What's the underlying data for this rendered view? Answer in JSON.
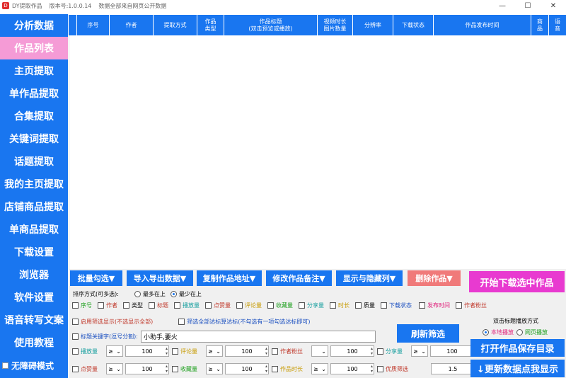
{
  "title": {
    "app_name": "DY提取作品",
    "version": "版本号:1.0.0.14",
    "note": "数据全部来自网页公开数据",
    "controls": [
      "—",
      "☐",
      "✕"
    ]
  },
  "sidebar": {
    "items": [
      "分析数据",
      "作品列表",
      "主页提取",
      "单作品提取",
      "合集提取",
      "关键词提取",
      "话题提取",
      "我的主页提取",
      "店铺商品提取",
      "单商品提取",
      "下载设置",
      "浏览器",
      "软件设置",
      "语音转写文案",
      "使用教程"
    ],
    "accessibility": "无障碍模式"
  },
  "table": {
    "headers": [
      "序号",
      "作者",
      "提取方式",
      "作品\n类型",
      "作品标题\n(双击预览或播放)",
      "视频时长\n图片数量",
      "分辨率",
      "下载状态",
      "作品发布时间",
      "商\n品",
      "语\n音"
    ]
  },
  "toolbar": {
    "batch_select": "批量勾选▼",
    "import_export": "导入导出数据▼",
    "copy_url": "复制作品地址▼",
    "edit_note": "修改作品备注▼",
    "show_hide": "显示与隐藏列▼",
    "delete": "删除作品▼",
    "start_download": "开始下载选中作品"
  },
  "sort": {
    "label": "排序方式(可多选):",
    "opt_most": "最多在上",
    "opt_least": "最少在上"
  },
  "columns": [
    {
      "label": "序号",
      "color": "#1a9e1a"
    },
    {
      "label": "作者",
      "color": "#c0392b"
    },
    {
      "label": "类型",
      "color": "#000000"
    },
    {
      "label": "标题",
      "color": "#c0392b"
    },
    {
      "label": "播放量",
      "color": "#1aa0a0"
    },
    {
      "label": "点赞量",
      "color": "#c0392b"
    },
    {
      "label": "评论量",
      "color": "#c79a00"
    },
    {
      "label": "收藏量",
      "color": "#1a9e1a"
    },
    {
      "label": "分享量",
      "color": "#1aa0a0"
    },
    {
      "label": "时长",
      "color": "#c79a00"
    },
    {
      "label": "质量",
      "color": "#000000"
    },
    {
      "label": "下载状态",
      "color": "#1a4fc0"
    },
    {
      "label": "发布时间",
      "color": "#e0207a"
    },
    {
      "label": "作者粉丝",
      "color": "#c0392b"
    }
  ],
  "filter": {
    "enable": "启用筛选显示(不选显示全部)",
    "all_match": "筛选全部达标算达标(不勾选有一项勾选达标即可)",
    "keyword_label": "标题关键字(逗号分割):",
    "keyword_value": "小助手,要火",
    "refresh": "刷新筛选",
    "op": "≥",
    "row1": [
      {
        "label": "播放量",
        "color": "#1aa0a0",
        "value": "100"
      },
      {
        "label": "评论量",
        "color": "#c79a00",
        "value": "100"
      },
      {
        "label": "作者粉丝",
        "color": "#c0392b",
        "value": "100"
      },
      {
        "label": "分享量",
        "color": "#1aa0a0",
        "value": "100"
      }
    ],
    "row2": [
      {
        "label": "点赞量",
        "color": "#c0392b",
        "value": "100"
      },
      {
        "label": "收藏量",
        "color": "#1a9e1a",
        "value": "100"
      },
      {
        "label": "作品时长",
        "color": "#c79a00",
        "value": "100"
      },
      {
        "label": "优质筛选",
        "color": "#c0392b",
        "value": "1.5"
      }
    ]
  },
  "play_mode": {
    "label": "双击标题播放方式",
    "local": "本地播放",
    "web": "网页播放"
  },
  "actions": {
    "open_dir": "打开作品保存目录",
    "update": "↓更新数据点我显示"
  }
}
